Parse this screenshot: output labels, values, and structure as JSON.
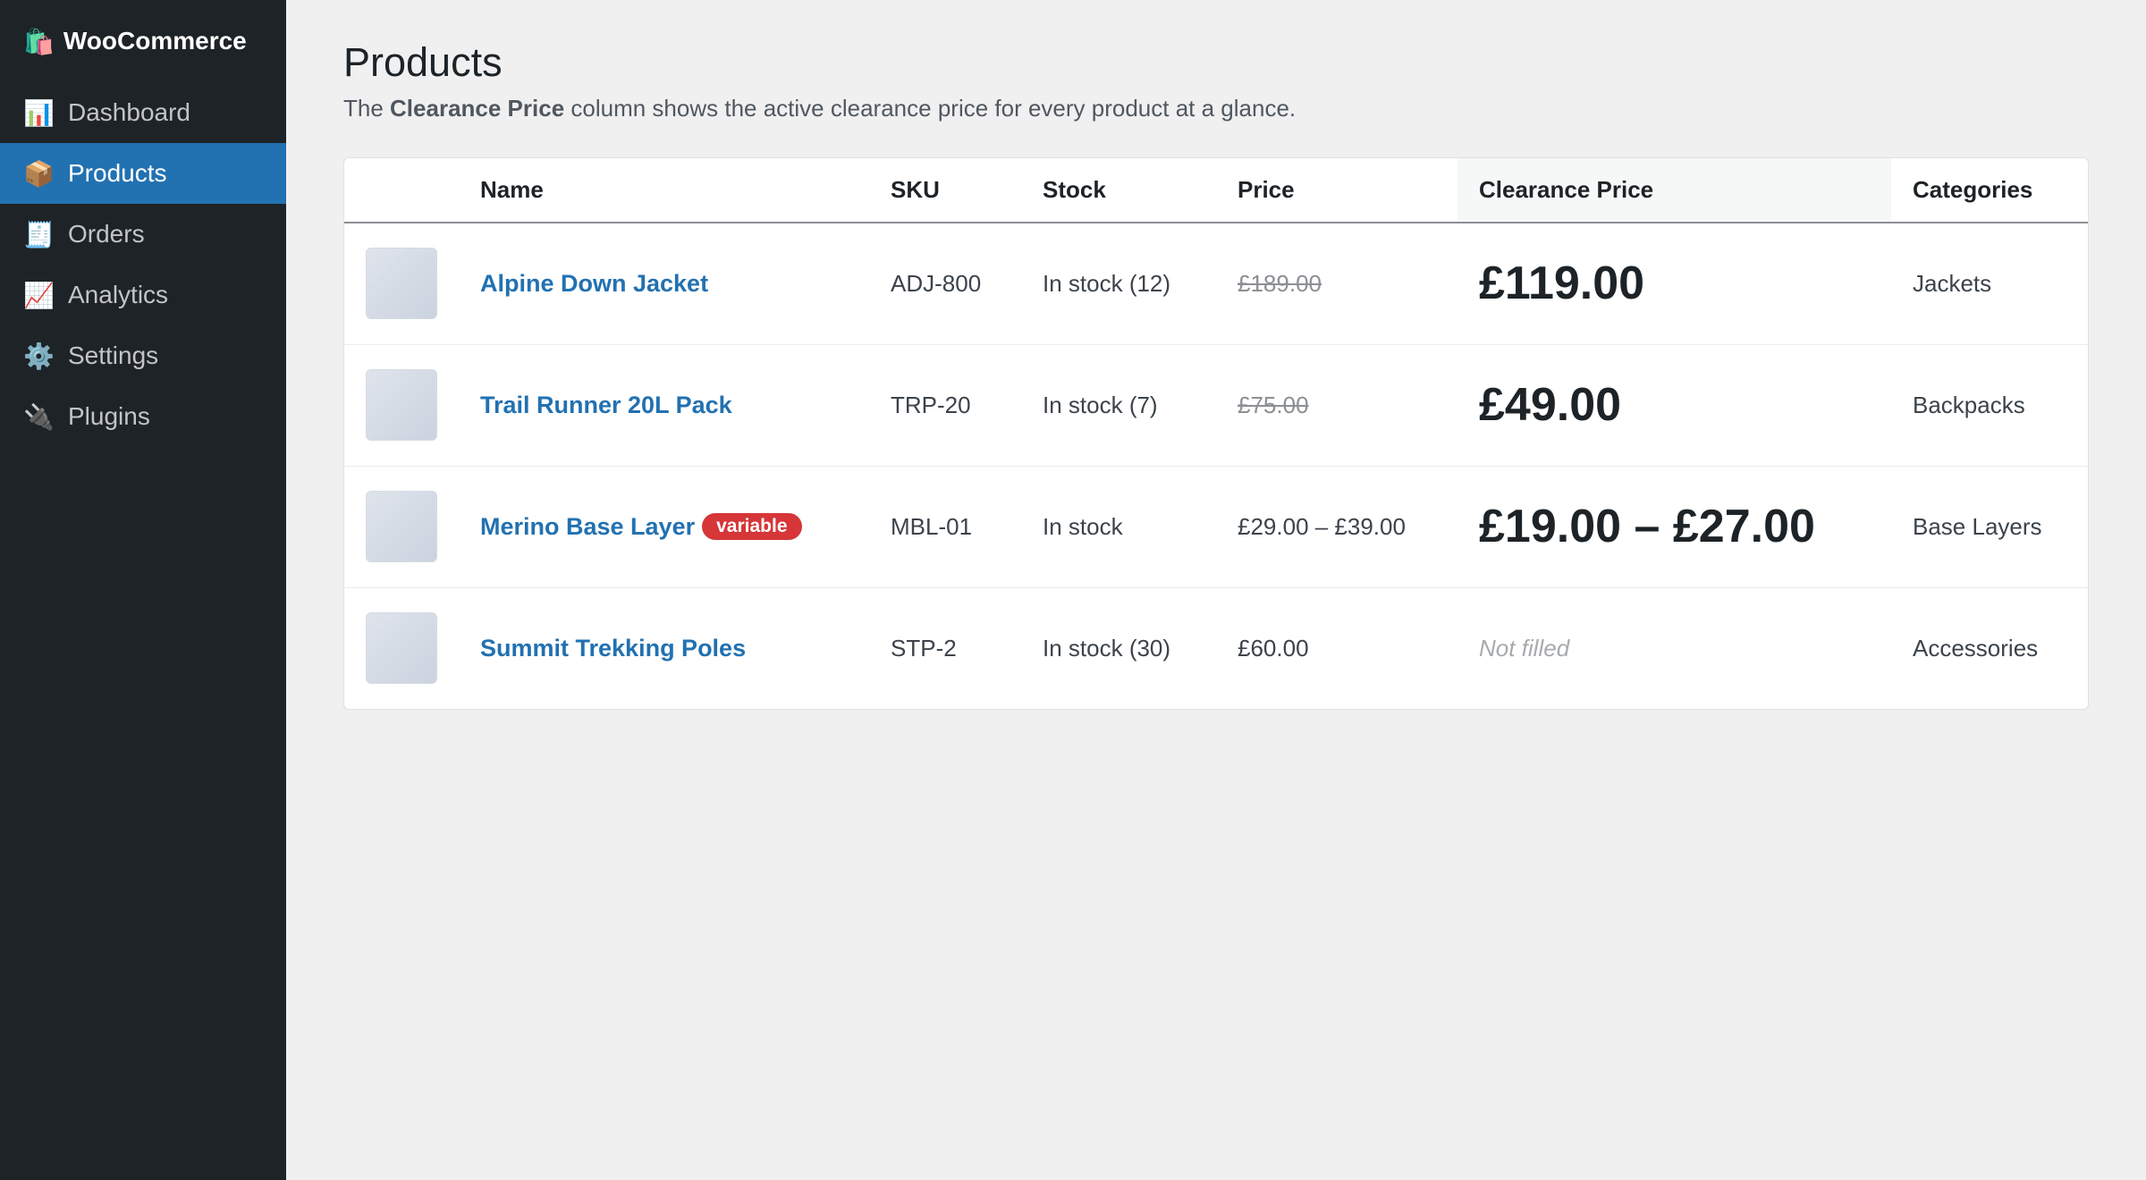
{
  "sidebar": {
    "brand": {
      "icon": "🛍️",
      "label": "WooCommerce"
    },
    "items": [
      {
        "icon": "📊",
        "icon_name": "chart-icon",
        "label": "Dashboard",
        "active": false
      },
      {
        "icon": "📦",
        "icon_name": "package-icon",
        "label": "Products",
        "active": true
      },
      {
        "icon": "🧾",
        "icon_name": "receipt-icon",
        "label": "Orders",
        "active": false
      },
      {
        "icon": "📈",
        "icon_name": "trend-icon",
        "label": "Analytics",
        "active": false
      },
      {
        "icon": "⚙️",
        "icon_name": "gear-icon",
        "label": "Settings",
        "active": false
      },
      {
        "icon": "🔌",
        "icon_name": "plug-icon",
        "label": "Plugins",
        "active": false
      }
    ]
  },
  "page": {
    "title": "Products",
    "desc_prefix": "The ",
    "desc_bold": "Clearance Price",
    "desc_suffix": " column shows the active clearance price for every product at a glance."
  },
  "table": {
    "headers": {
      "name": "Name",
      "sku": "SKU",
      "stock": "Stock",
      "price": "Price",
      "clearance": "Clearance Price",
      "categories": "Categories"
    },
    "rows": [
      {
        "name": "Alpine Down Jacket",
        "badge": "",
        "sku": "ADJ-800",
        "stock": "In stock (12)",
        "price": "£189.00",
        "price_struck": true,
        "clearance": "£119.00",
        "category": "Jackets"
      },
      {
        "name": "Trail Runner 20L Pack",
        "badge": "",
        "sku": "TRP-20",
        "stock": "In stock (7)",
        "price": "£75.00",
        "price_struck": true,
        "clearance": "£49.00",
        "category": "Backpacks"
      },
      {
        "name": "Merino Base Layer",
        "badge": "variable",
        "sku": "MBL-01",
        "stock": "In stock",
        "price": "£29.00 – £39.00",
        "price_struck": false,
        "clearance": "£19.00 – £27.00",
        "category": "Base Layers"
      },
      {
        "name": "Summit Trekking Poles",
        "badge": "",
        "sku": "STP-2",
        "stock": "In stock (30)",
        "price": "£60.00",
        "price_struck": false,
        "clearance": "Not filled",
        "clearance_empty": true,
        "category": "Accessories"
      }
    ]
  },
  "colors": {
    "sidebar_bg": "#1d2327",
    "active_item": "#2271b1",
    "link": "#2271b1",
    "badge": "#d63638"
  }
}
